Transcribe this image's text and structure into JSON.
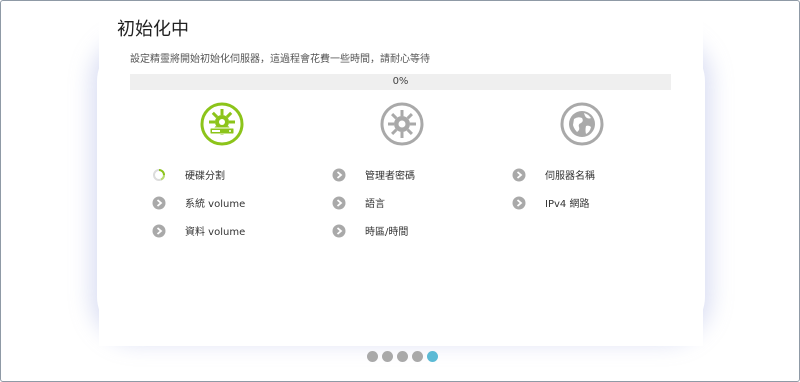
{
  "dialog": {
    "title": "初始化中",
    "subtitle": "設定精靈將開始初始化伺服器，這過程會花費一些時間，請耐心等待"
  },
  "progress": {
    "value": 0,
    "label": "0%",
    "fill_color": "#8cc41a"
  },
  "stages": [
    {
      "icon": "gear-disk-icon",
      "state": "active",
      "color": "#8cc41a"
    },
    {
      "icon": "gear-icon",
      "state": "pending",
      "color": "#a9a9a9"
    },
    {
      "icon": "globe-icon",
      "state": "pending",
      "color": "#a9a9a9"
    }
  ],
  "tasks": {
    "col1": [
      {
        "label": "硬碟分割",
        "status": "in-progress"
      },
      {
        "label": "系統 volume",
        "status": "pending"
      },
      {
        "label": "資料 volume",
        "status": "pending"
      }
    ],
    "col2": [
      {
        "label": "管理者密碼",
        "status": "pending"
      },
      {
        "label": "語言",
        "status": "pending"
      },
      {
        "label": "時區/時間",
        "status": "pending"
      }
    ],
    "col3": [
      {
        "label": "伺服器名稱",
        "status": "pending"
      },
      {
        "label": "IPv4 網路",
        "status": "pending"
      }
    ]
  },
  "pager": {
    "count": 5,
    "active_index": 4,
    "active_color": "#5bbad5"
  }
}
